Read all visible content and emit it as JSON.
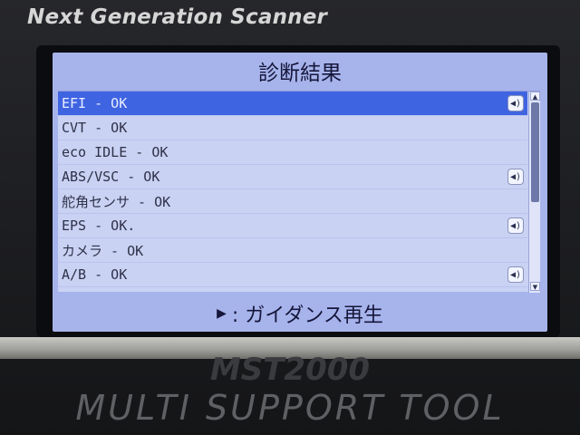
{
  "device": {
    "brand": "Next Generation Scanner",
    "model": "MST2000",
    "tool_name": "MULTI SUPPORT TOOL"
  },
  "screen": {
    "title": "診断結果",
    "items": [
      {
        "label": "EFI - OK",
        "speaker": true,
        "selected": true
      },
      {
        "label": "CVT - OK",
        "speaker": false,
        "selected": false
      },
      {
        "label": "eco IDLE - OK",
        "speaker": false,
        "selected": false
      },
      {
        "label": "ABS/VSC - OK",
        "speaker": true,
        "selected": false
      },
      {
        "label": "舵角センサ - OK",
        "speaker": false,
        "selected": false
      },
      {
        "label": "EPS - OK.",
        "speaker": true,
        "selected": false
      },
      {
        "label": "カメラ - OK",
        "speaker": false,
        "selected": false
      },
      {
        "label": "A/B - OK",
        "speaker": true,
        "selected": false
      }
    ],
    "footer": ": ガイダンス再生"
  },
  "icons": {
    "speaker": "speaker-icon",
    "footer_arrow": "play-triangle-icon",
    "scroll_up": "scroll-up-arrow-icon",
    "scroll_down": "scroll-down-arrow-icon"
  },
  "colors": {
    "screen_bg": "#a7b4ec",
    "list_bg": "#c9d2f3",
    "selected_row": "#3f64e2"
  }
}
